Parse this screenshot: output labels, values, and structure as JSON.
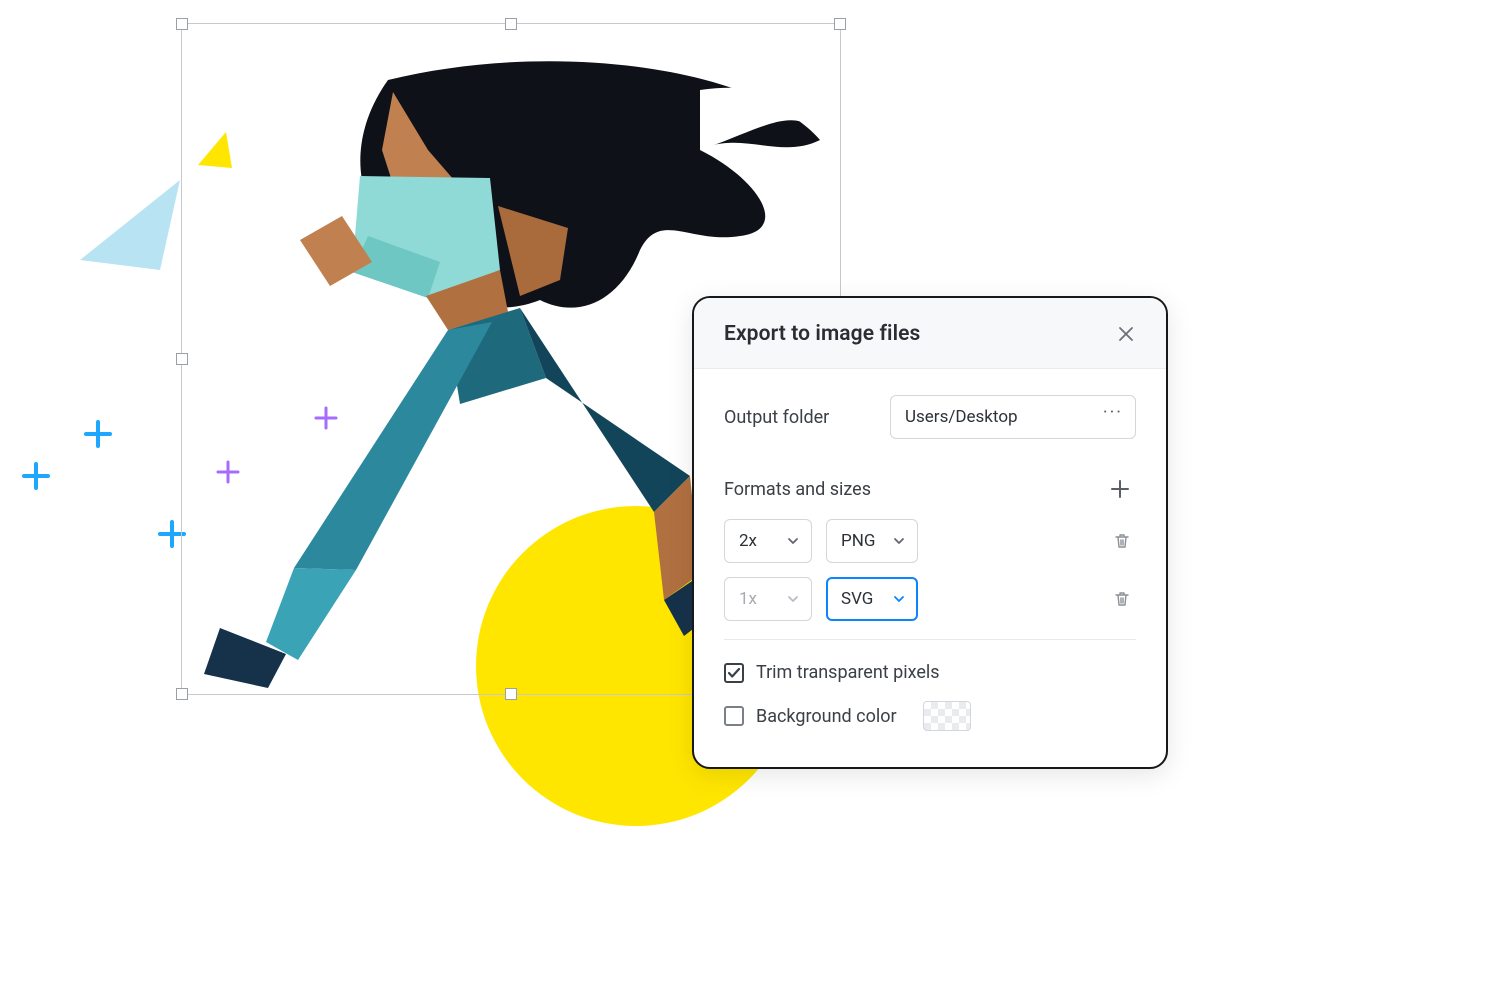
{
  "panel": {
    "title": "Export to image files",
    "output_folder_label": "Output folder",
    "output_folder_value": "Users/Desktop",
    "formats_section_label": "Formats and sizes",
    "rows": [
      {
        "size": "2x",
        "format": "PNG",
        "size_enabled": true,
        "format_active": false
      },
      {
        "size": "1x",
        "format": "SVG",
        "size_enabled": false,
        "format_active": true
      }
    ],
    "checkboxes": {
      "trim_label": "Trim transparent pixels",
      "trim_checked": true,
      "bg_label": "Background color",
      "bg_checked": false
    }
  }
}
